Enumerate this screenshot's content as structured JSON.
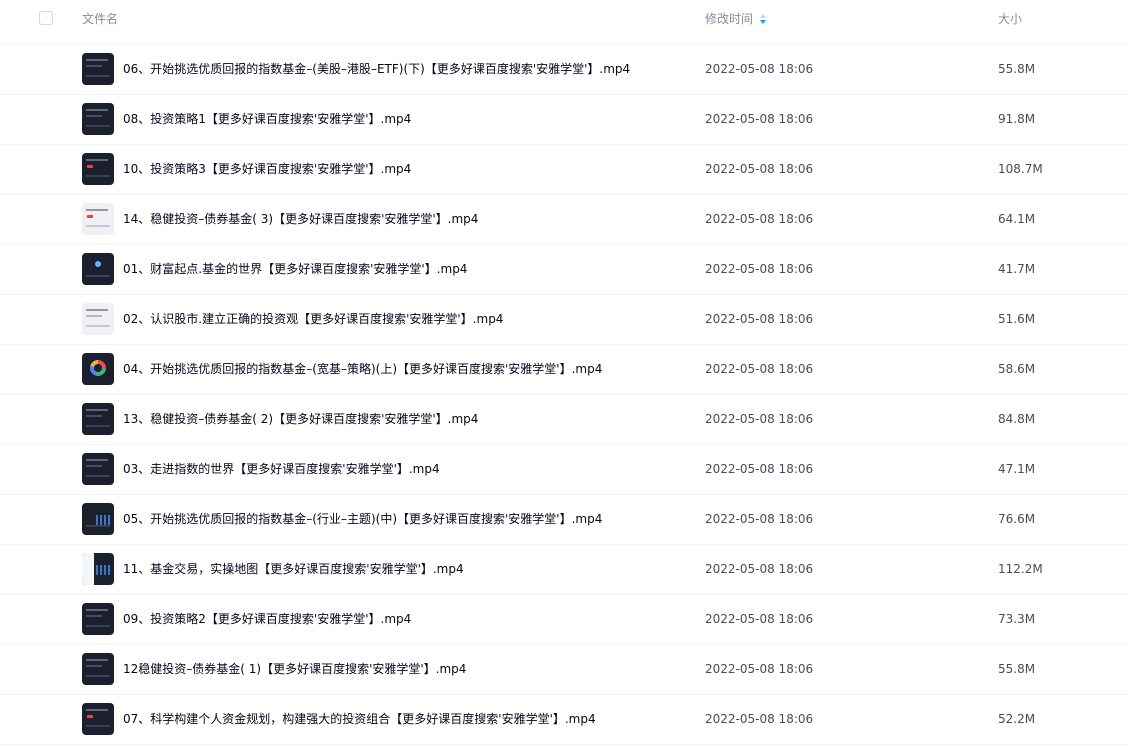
{
  "header": {
    "col_name": "文件名",
    "col_time": "修改时间",
    "col_size": "大小",
    "sort_icon": "sort-icon"
  },
  "files": [
    {
      "name": "06、开始挑选优质回报的指数基金–(美股–港股–ETF)(下)【更多好课百度搜索'安雅学堂'】.mp4",
      "time": "2022-05-08 18:06",
      "size": "55.8M",
      "thumb_icon": "video-thumbnail-icon"
    },
    {
      "name": "08、投资策略1【更多好课百度搜索'安雅学堂'】.mp4",
      "time": "2022-05-08 18:06",
      "size": "91.8M",
      "thumb_icon": "video-thumbnail-icon"
    },
    {
      "name": "10、投资策略3【更多好课百度搜索'安雅学堂'】.mp4",
      "time": "2022-05-08 18:06",
      "size": "108.7M",
      "thumb_icon": "video-thumbnail-icon"
    },
    {
      "name": "14、稳健投资–债券基金( 3)【更多好课百度搜索'安雅学堂'】.mp4",
      "time": "2022-05-08 18:06",
      "size": "64.1M",
      "thumb_icon": "video-thumbnail-icon"
    },
    {
      "name": "01、财富起点.基金的世界【更多好课百度搜索'安雅学堂'】.mp4",
      "time": "2022-05-08 18:06",
      "size": "41.7M",
      "thumb_icon": "video-thumbnail-icon"
    },
    {
      "name": "02、认识股市.建立正确的投资观【更多好课百度搜索'安雅学堂'】.mp4",
      "time": "2022-05-08 18:06",
      "size": "51.6M",
      "thumb_icon": "video-thumbnail-icon"
    },
    {
      "name": "04、开始挑选优质回报的指数基金–(宽基–策略)(上)【更多好课百度搜索'安雅学堂'】.mp4",
      "time": "2022-05-08 18:06",
      "size": "58.6M",
      "thumb_icon": "video-thumbnail-icon"
    },
    {
      "name": "13、稳健投资–债券基金( 2)【更多好课百度搜索'安雅学堂'】.mp4",
      "time": "2022-05-08 18:06",
      "size": "84.8M",
      "thumb_icon": "video-thumbnail-icon"
    },
    {
      "name": "03、走进指数的世界【更多好课百度搜索'安雅学堂'】.mp4",
      "time": "2022-05-08 18:06",
      "size": "47.1M",
      "thumb_icon": "video-thumbnail-icon"
    },
    {
      "name": "05、开始挑选优质回报的指数基金–(行业–主题)(中)【更多好课百度搜索'安雅学堂'】.mp4",
      "time": "2022-05-08 18:06",
      "size": "76.6M",
      "thumb_icon": "video-thumbnail-icon"
    },
    {
      "name": "11、基金交易，实操地图【更多好课百度搜索'安雅学堂'】.mp4",
      "time": "2022-05-08 18:06",
      "size": "112.2M",
      "thumb_icon": "video-thumbnail-icon"
    },
    {
      "name": "09、投资策略2【更多好课百度搜索'安雅学堂'】.mp4",
      "time": "2022-05-08 18:06",
      "size": "73.3M",
      "thumb_icon": "video-thumbnail-icon"
    },
    {
      "name": "12稳健投资–债券基金( 1)【更多好课百度搜索'安雅学堂'】.mp4",
      "time": "2022-05-08 18:06",
      "size": "55.8M",
      "thumb_icon": "video-thumbnail-icon"
    },
    {
      "name": "07、科学构建个人资金规划，构建强大的投资组合【更多好课百度搜索'安雅学堂'】.mp4",
      "time": "2022-05-08 18:06",
      "size": "52.2M",
      "thumb_icon": "video-thumbnail-icon"
    }
  ],
  "colors": {
    "sort_accent": "#06a7ff",
    "row_divider": "#f1f2f4",
    "header_text": "#878c9c"
  }
}
